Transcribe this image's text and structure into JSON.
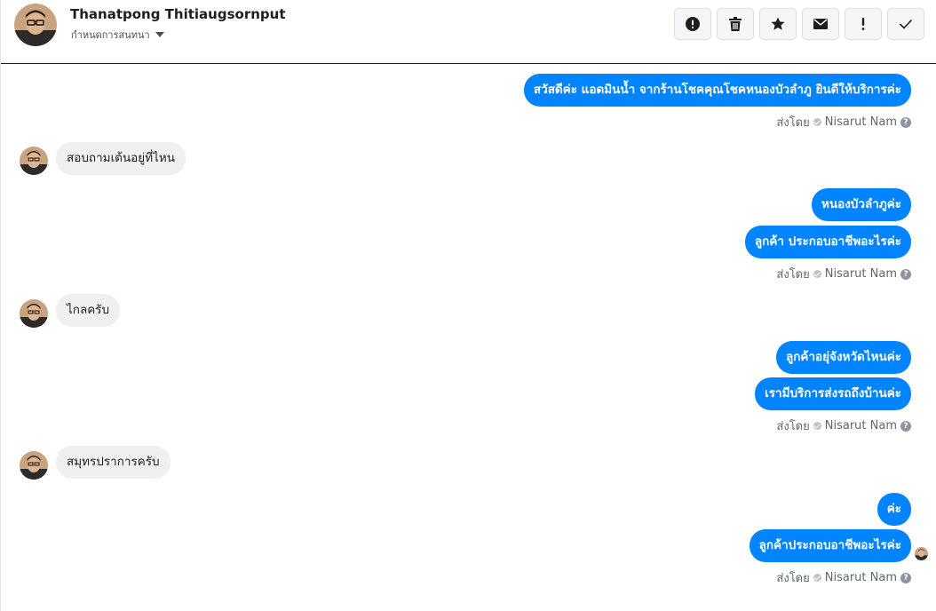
{
  "header": {
    "contact_name": "Thanatpong Thitiaugsornput",
    "assign_label": "กำหนดการสนทนา",
    "toolbar": [
      {
        "name": "mark-spam-button",
        "icon": "exclamation-circle-icon"
      },
      {
        "name": "delete-button",
        "icon": "trash-icon"
      },
      {
        "name": "star-button",
        "icon": "star-icon"
      },
      {
        "name": "mark-unread-button",
        "icon": "envelope-icon"
      },
      {
        "name": "follow-up-button",
        "icon": "exclamation-icon"
      },
      {
        "name": "mark-done-button",
        "icon": "check-icon"
      }
    ]
  },
  "messages": {
    "m1": "สวัสดีค่ะ แอดมินน้ำ จากร้านโชคคุณโชคหนองบัวลำภู ยินดีให้บริการค่ะ",
    "m2": "สอบถามเต้นอยู่ที่ไหน",
    "m3": "หนองบัวลำภูค่ะ",
    "m4": "ลูกค้า ประกอบอาชีพอะไรค่ะ",
    "m5": "ไกลครับ",
    "m6": "ลูกค้าอยุ่จังหวัดไหนค่ะ",
    "m7": "เรามีบริการส่งรถถึงบ้านค่ะ",
    "m8": "สมุทรปราการครับ",
    "m9": "ค่ะ",
    "m10": "ลูกค้าประกอบอาชีพอะไรค่ะ"
  },
  "sent_by": {
    "prefix": "ส่งโดย",
    "agent": "Nisarut Nam",
    "help_glyph": "?"
  },
  "colors": {
    "outgoing_bubble": "#0084ff",
    "incoming_bubble": "#f0f0f0",
    "meta_text": "#606770"
  }
}
